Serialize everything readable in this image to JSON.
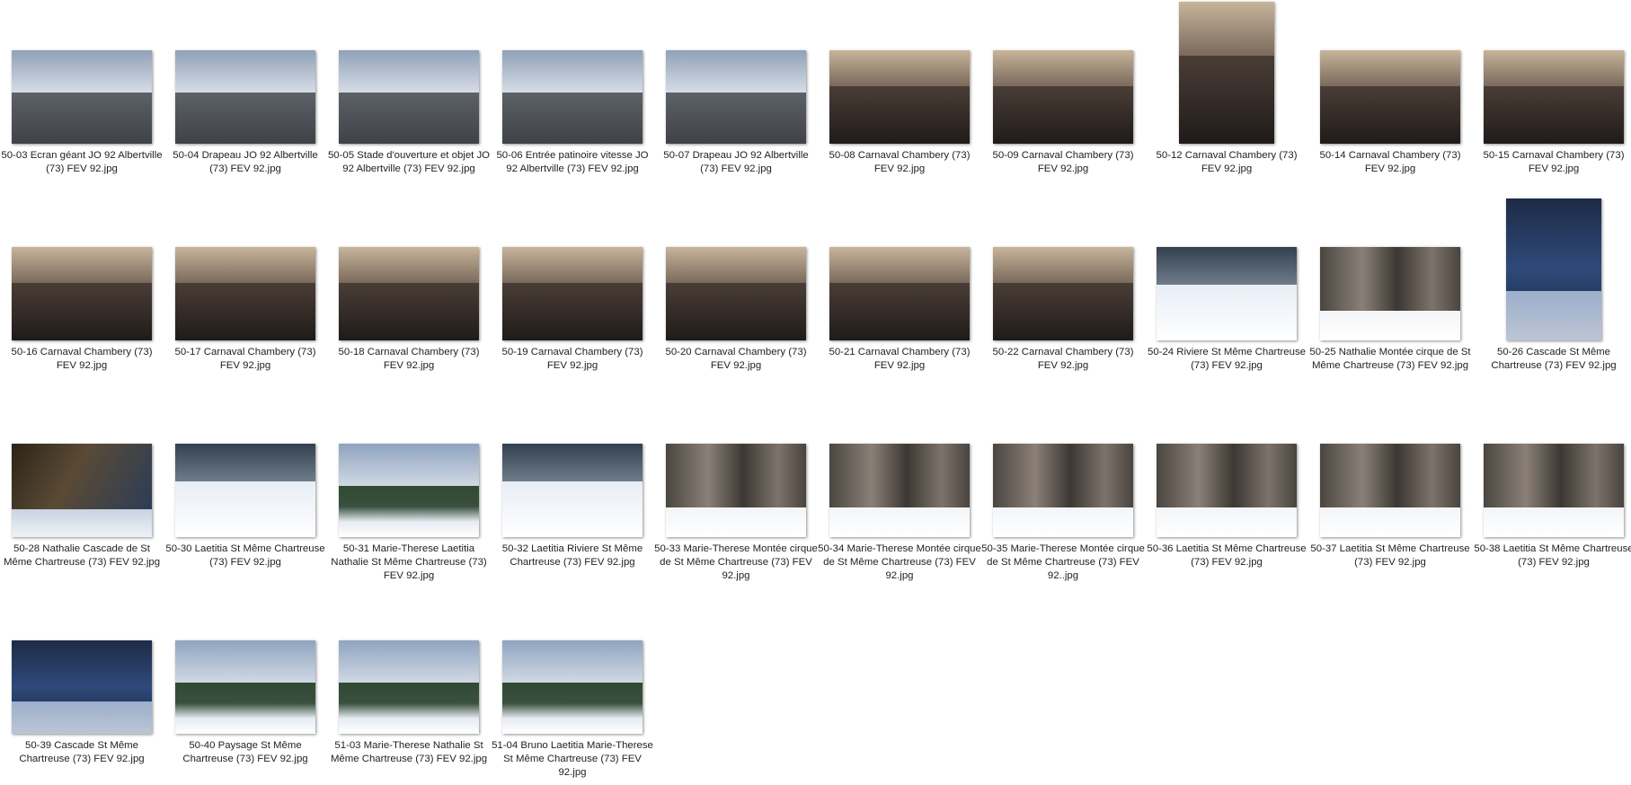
{
  "files": [
    {
      "caption": "50-03 Ecran géant JO 92 Albertville (73) FEV 92.jpg",
      "theme": "olymp",
      "orientation": "landscape"
    },
    {
      "caption": "50-04 Drapeau JO 92 Albertville (73) FEV 92.jpg",
      "theme": "olymp",
      "orientation": "landscape"
    },
    {
      "caption": "50-05 Stade d'ouverture et objet JO 92 Albertville (73) FEV 92.jpg",
      "theme": "olymp",
      "orientation": "landscape"
    },
    {
      "caption": "50-06 Entrée patinoire vitesse JO 92 Albertville (73) FEV 92.jpg",
      "theme": "olymp",
      "orientation": "landscape"
    },
    {
      "caption": "50-07 Drapeau JO 92 Albertville (73) FEV 92.jpg",
      "theme": "olymp",
      "orientation": "landscape"
    },
    {
      "caption": "50-08 Carnaval Chambery (73) FEV 92.jpg",
      "theme": "carn",
      "orientation": "landscape"
    },
    {
      "caption": "50-09 Carnaval Chambery (73) FEV 92.jpg",
      "theme": "carn",
      "orientation": "landscape"
    },
    {
      "caption": "50-12 Carnaval Chambery (73) FEV 92.jpg",
      "theme": "carn",
      "orientation": "portrait"
    },
    {
      "caption": "50-14 Carnaval Chambery (73) FEV 92.jpg",
      "theme": "carn",
      "orientation": "landscape"
    },
    {
      "caption": "50-15 Carnaval Chambery (73) FEV 92.jpg",
      "theme": "carn",
      "orientation": "landscape"
    },
    {
      "caption": "50-16 Carnaval Chambery (73) FEV 92.jpg",
      "theme": "carn",
      "orientation": "landscape"
    },
    {
      "caption": "50-17 Carnaval Chambery (73) FEV 92.jpg",
      "theme": "carn",
      "orientation": "landscape"
    },
    {
      "caption": "50-18 Carnaval Chambery (73) FEV 92.jpg",
      "theme": "carn",
      "orientation": "landscape"
    },
    {
      "caption": "50-19 Carnaval Chambery (73) FEV 92.jpg",
      "theme": "carn",
      "orientation": "landscape"
    },
    {
      "caption": "50-20 Carnaval Chambery (73) FEV 92.jpg",
      "theme": "carn",
      "orientation": "landscape"
    },
    {
      "caption": "50-21 Carnaval Chambery (73) FEV 92.jpg",
      "theme": "carn",
      "orientation": "landscape"
    },
    {
      "caption": "50-22 Carnaval Chambery (73) FEV 92.jpg",
      "theme": "carn",
      "orientation": "landscape"
    },
    {
      "caption": "50-24 Riviere St Même Chartreuse (73) FEV 92.jpg",
      "theme": "snow",
      "orientation": "landscape"
    },
    {
      "caption": "50-25 Nathalie Montée cirque de St Même Chartreuse (73) FEV 92.jpg",
      "theme": "forest",
      "orientation": "landscape"
    },
    {
      "caption": "50-26 Cascade St Même Chartreuse (73) FEV 92.jpg",
      "theme": "water",
      "orientation": "portrait"
    },
    {
      "caption": "50-28 Nathalie Cascade de St Même Chartreuse (73) FEV 92.jpg",
      "theme": "portrait",
      "orientation": "landscape"
    },
    {
      "caption": "50-30 Laetitia St Même Chartreuse (73) FEV 92.jpg",
      "theme": "snow",
      "orientation": "landscape"
    },
    {
      "caption": "50-31 Marie-Therese Laetitia Nathalie St Même Chartreuse (73) FEV 92.jpg",
      "theme": "mount",
      "orientation": "landscape"
    },
    {
      "caption": "50-32 Laetitia Riviere St Même Chartreuse (73) FEV 92.jpg",
      "theme": "snow",
      "orientation": "landscape"
    },
    {
      "caption": "50-33 Marie-Therese Montée cirque de St Même Chartreuse (73) FEV 92.jpg",
      "theme": "forest",
      "orientation": "landscape"
    },
    {
      "caption": "50-34 Marie-Therese Montée cirque de St Même Chartreuse (73) FEV 92.jpg",
      "theme": "forest",
      "orientation": "landscape"
    },
    {
      "caption": "50-35 Marie-Therese Montée cirque de St Même Chartreuse (73) FEV 92..jpg",
      "theme": "forest",
      "orientation": "landscape"
    },
    {
      "caption": "50-36 Laetitia St Même Chartreuse (73) FEV 92.jpg",
      "theme": "forest",
      "orientation": "landscape"
    },
    {
      "caption": "50-37 Laetitia St Même Chartreuse (73) FEV 92.jpg",
      "theme": "forest",
      "orientation": "landscape"
    },
    {
      "caption": "50-38 Laetitia St Même Chartreuse (73) FEV 92.jpg",
      "theme": "forest",
      "orientation": "landscape"
    },
    {
      "caption": "50-39 Cascade St Même Chartreuse (73) FEV 92.jpg",
      "theme": "water",
      "orientation": "landscape"
    },
    {
      "caption": "50-40 Paysage St Même Chartreuse (73) FEV 92.jpg",
      "theme": "mount",
      "orientation": "landscape"
    },
    {
      "caption": "51-03 Marie-Therese Nathalie St Même Chartreuse (73) FEV 92.jpg",
      "theme": "mount",
      "orientation": "landscape"
    },
    {
      "caption": "51-04 Bruno Laetitia Marie-Therese St Même Chartreuse (73) FEV 92.jpg",
      "theme": "mount",
      "orientation": "landscape"
    }
  ]
}
